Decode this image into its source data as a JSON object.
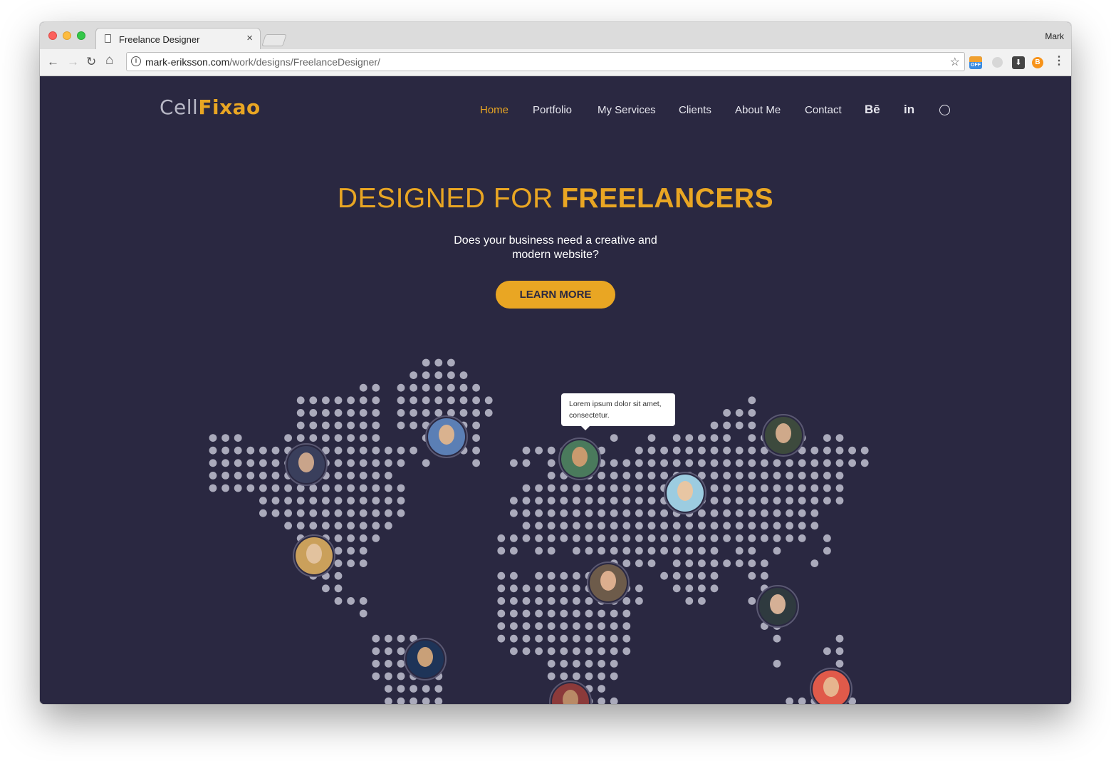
{
  "browser": {
    "tab_title": "Freelance Designer",
    "tab_close": "×",
    "profile_name": "Mark",
    "url_host": "mark-eriksson.com",
    "url_path": "/work/designs/FreelanceDesigner/",
    "ext_off_label": "OFF",
    "ext_btc_label": "B",
    "back_icon": "←",
    "forward_icon": "→",
    "reload_icon": "↻",
    "home_icon": "⌂",
    "star_icon": "☆",
    "menu_icon": "⋮",
    "download_icon": "⬇",
    "info_icon": "i"
  },
  "site": {
    "logo_part1": "Cell",
    "logo_part2": "Fixao",
    "nav": [
      "Home",
      "Portfolio",
      "My Services",
      "Clients",
      "About Me",
      "Contact"
    ],
    "active_nav": "Home",
    "social": {
      "behance": "Bē",
      "linkedin": "in",
      "dribbble_icon": "dribbble-icon"
    }
  },
  "hero": {
    "title_light": "DESIGNED FOR ",
    "title_bold": "FREELANCERS",
    "subtitle": "Does your business need a creative and modern website?",
    "cta_label": "LEARN MORE"
  },
  "map": {
    "tooltip": "Lorem ipsum dolor sit amet, consectetur."
  },
  "colors": {
    "background": "#2a2841",
    "accent": "#e9a623",
    "dots": "#aaaabb"
  }
}
